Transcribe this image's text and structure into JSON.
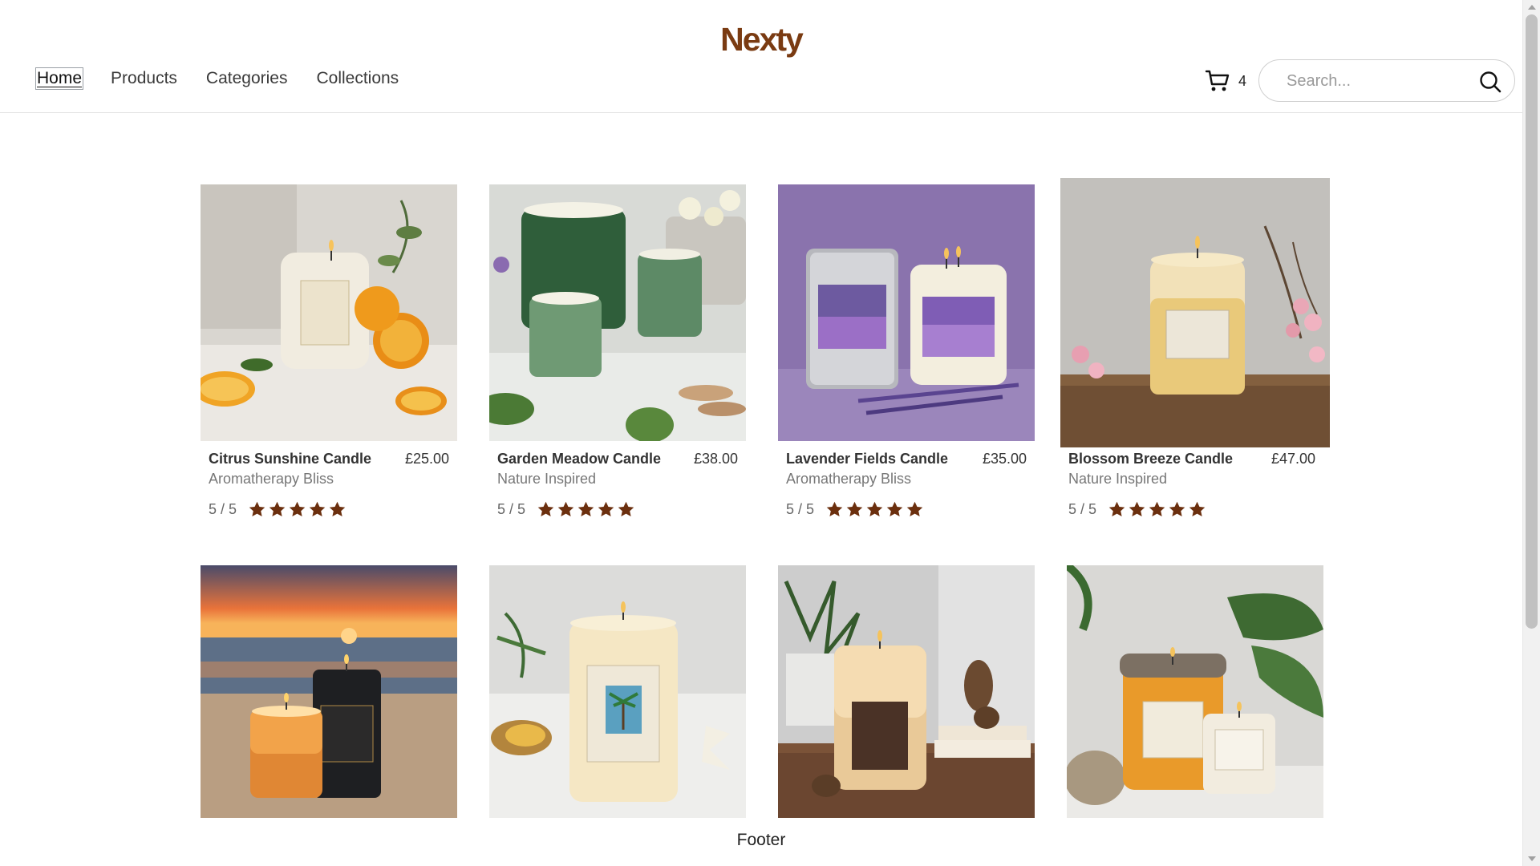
{
  "brand": {
    "logo": "Nexty",
    "color": "#7a3b12"
  },
  "nav": [
    {
      "label": "Home",
      "active": true
    },
    {
      "label": "Products",
      "active": false
    },
    {
      "label": "Categories",
      "active": false
    },
    {
      "label": "Collections",
      "active": false
    }
  ],
  "cart": {
    "icon": "cart-icon",
    "count": "4"
  },
  "search": {
    "placeholder": "Search...",
    "icon": "search-icon"
  },
  "products": [
    {
      "name": "Citrus Sunshine Candle",
      "price": "£25.00",
      "collection": "Aromatherapy Bliss",
      "rating_text": "5 / 5",
      "rating": 5
    },
    {
      "name": "Garden Meadow Candle",
      "price": "£38.00",
      "collection": "Nature Inspired",
      "rating_text": "5 / 5",
      "rating": 5
    },
    {
      "name": "Lavender Fields Candle",
      "price": "£35.00",
      "collection": "Aromatherapy Bliss",
      "rating_text": "5 / 5",
      "rating": 5
    },
    {
      "name": "Blossom Breeze Candle",
      "price": "£47.00",
      "collection": "Nature Inspired",
      "rating_text": "5 / 5",
      "rating": 5
    },
    {
      "name": "",
      "price": "",
      "collection": "",
      "rating_text": "",
      "rating": null
    },
    {
      "name": "",
      "price": "",
      "collection": "",
      "rating_text": "",
      "rating": null
    },
    {
      "name": "",
      "price": "",
      "collection": "",
      "rating_text": "",
      "rating": null
    },
    {
      "name": "",
      "price": "",
      "collection": "",
      "rating_text": "",
      "rating": null
    }
  ],
  "star_color": "#6b2f0e",
  "footer": {
    "label": "Footer"
  }
}
